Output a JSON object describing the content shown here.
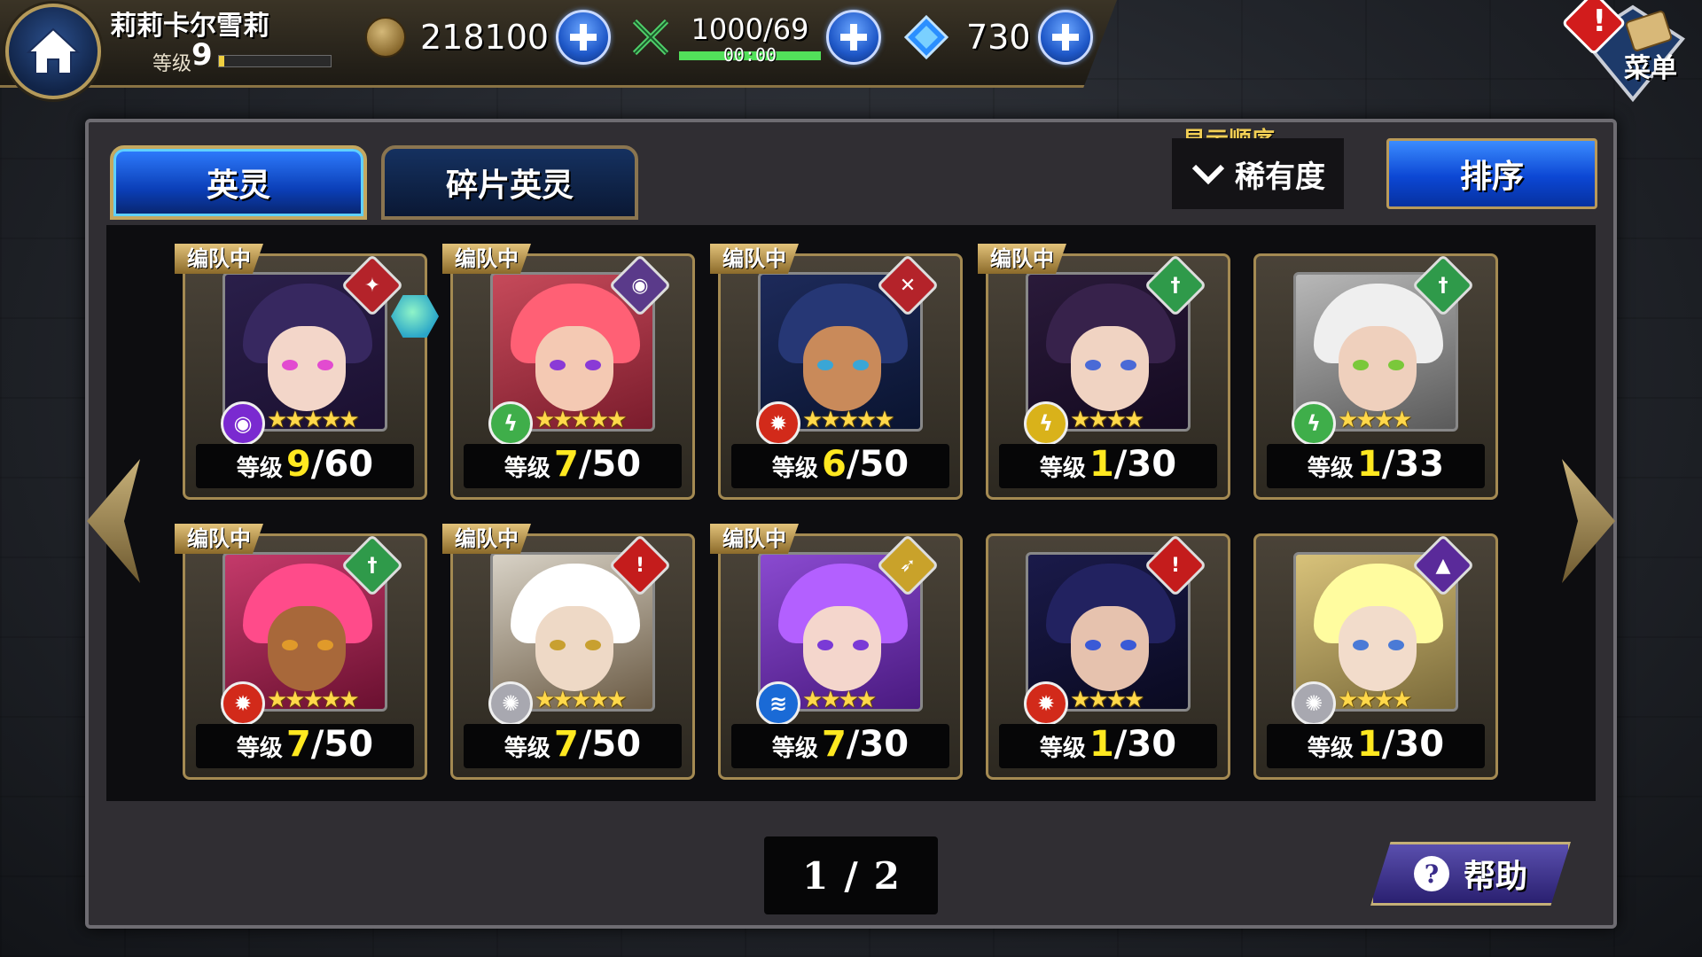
{
  "header": {
    "player_name": "莉莉卡尔雪莉",
    "level_label": "等级",
    "level_value": "9",
    "level_progress": 0.05,
    "gold": "218100",
    "stamina": "1000/69",
    "stamina_timer": "00:00",
    "stamina_progress": 1.0,
    "gems": "730",
    "menu_label": "菜单",
    "alert_mark": "!"
  },
  "tabs": [
    {
      "label": "英灵",
      "active": true
    },
    {
      "label": "碎片英灵",
      "active": false
    }
  ],
  "sort": {
    "caption": "显示顺序",
    "selected": "稀有度",
    "button_label": "排序"
  },
  "deploy_tag": "编队中",
  "level_prefix": "等级",
  "cards": [
    {
      "deployed": true,
      "class_icon": "staff-icon",
      "class_color": "#b4232a",
      "element_icon": "eye-icon",
      "element_color": "#7a2ad0",
      "stars": "★★★★★",
      "level": "9",
      "max": "/60",
      "palette": [
        "#2a1f4a",
        "#1b1030"
      ],
      "skin": "#f3d6c9",
      "eye": "#e24bd0",
      "extra_icon": "book-icon"
    },
    {
      "deployed": true,
      "class_icon": "eye-icon",
      "class_color": "#5a3a8a",
      "element_icon": "wind-icon",
      "element_color": "#3fae4a",
      "stars": "★★★★★",
      "level": "7",
      "max": "/50",
      "palette": [
        "#c64a5a",
        "#7a1c2c"
      ],
      "skin": "#f4c9b3",
      "eye": "#8a3ad6",
      "extra_icon": ""
    },
    {
      "deployed": true,
      "class_icon": "swords-icon",
      "class_color": "#b4232a",
      "element_icon": "fire-icon",
      "element_color": "#d22a1a",
      "stars": "★★★★★",
      "level": "6",
      "max": "/50",
      "palette": [
        "#1d2a5a",
        "#0a1430"
      ],
      "skin": "#c98a5a",
      "eye": "#3aa6d6",
      "extra_icon": ""
    },
    {
      "deployed": true,
      "class_icon": "sword-icon",
      "class_color": "#2f9a4a",
      "element_icon": "thunder-icon",
      "element_color": "#d9b21a",
      "stars": "★★★★",
      "level": "1",
      "max": "/30",
      "palette": [
        "#2a1a3a",
        "#140a20"
      ],
      "skin": "#f0d3c2",
      "eye": "#4a6ad6",
      "extra_icon": ""
    },
    {
      "deployed": false,
      "class_icon": "sword-icon",
      "class_color": "#2f9a4a",
      "element_icon": "wind-icon",
      "element_color": "#3fae4a",
      "stars": "★★★★",
      "level": "1",
      "max": "/33",
      "palette": [
        "#b8b8b8",
        "#5a5a5a"
      ],
      "skin": "#efd0bd",
      "eye": "#7ac83a",
      "extra_icon": ""
    },
    {
      "deployed": true,
      "class_icon": "sword-icon",
      "class_color": "#2f9a4a",
      "element_icon": "fire-icon",
      "element_color": "#d22a1a",
      "stars": "★★★★★",
      "level": "7",
      "max": "/50",
      "palette": [
        "#c43a6a",
        "#6a1030"
      ],
      "skin": "#a8683a",
      "eye": "#e09a2a",
      "extra_icon": ""
    },
    {
      "deployed": true,
      "class_icon": "lance-icon",
      "class_color": "#c41c1c",
      "element_icon": "light-icon",
      "element_color": "#a8a8b0",
      "stars": "★★★★★",
      "level": "7",
      "max": "/50",
      "palette": [
        "#d8d2c6",
        "#6a5a44"
      ],
      "skin": "#eed9c6",
      "eye": "#c8a030",
      "extra_icon": ""
    },
    {
      "deployed": true,
      "class_icon": "bow-icon",
      "class_color": "#c9a22a",
      "element_icon": "water-icon",
      "element_color": "#1a6ad6",
      "stars": "★★★★",
      "level": "7",
      "max": "/30",
      "palette": [
        "#8a4ad0",
        "#4a1a80"
      ],
      "skin": "#f4d6cc",
      "eye": "#7a3ad6",
      "extra_icon": ""
    },
    {
      "deployed": false,
      "class_icon": "lance-icon",
      "class_color": "#c41c1c",
      "element_icon": "fire-icon",
      "element_color": "#d22a1a",
      "stars": "★★★★",
      "level": "1",
      "max": "/30",
      "palette": [
        "#1a1a4a",
        "#0a0a20"
      ],
      "skin": "#e6c2ae",
      "eye": "#3a5ad6",
      "extra_icon": ""
    },
    {
      "deployed": false,
      "class_icon": "hat-icon",
      "class_color": "#5a2a9a",
      "element_icon": "light-icon",
      "element_color": "#a8a8b0",
      "stars": "★★★★",
      "level": "1",
      "max": "/30",
      "palette": [
        "#d8c27a",
        "#7a6a3a"
      ],
      "skin": "#f2dccb",
      "eye": "#4a7ad6",
      "extra_icon": ""
    }
  ],
  "pager": {
    "current": "1",
    "sep": "/",
    "total": "2"
  },
  "help_label": "帮助",
  "colors": {
    "accent_blue": "#0c47d4",
    "gold_border": "#a48a52",
    "level_yellow": "#ffe820"
  }
}
